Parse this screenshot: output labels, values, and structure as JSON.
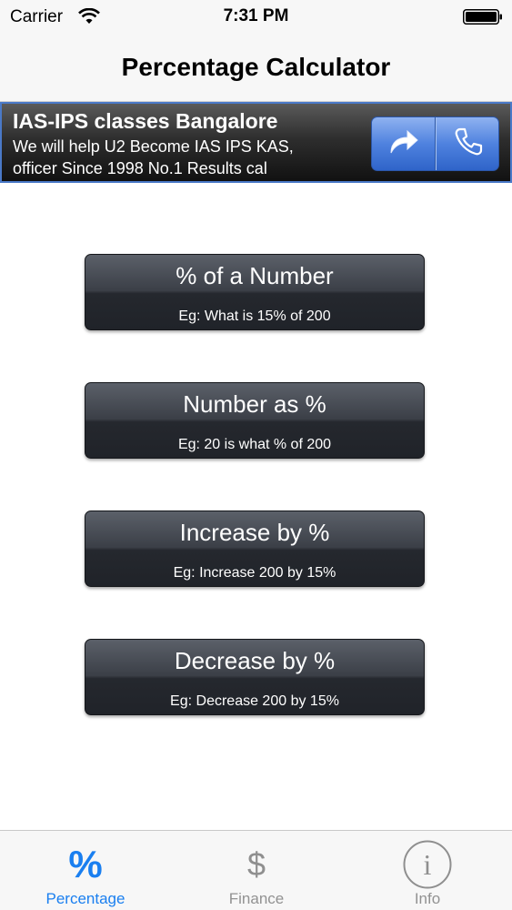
{
  "status_bar": {
    "carrier": "Carrier",
    "time": "7:31 PM"
  },
  "nav": {
    "title": "Percentage Calculator"
  },
  "ad": {
    "title": "IAS-IPS classes Bangalore",
    "line1": "We will help U2 Become IAS IPS KAS,",
    "line2": "officer Since 1998 No.1 Results cal",
    "buttons": [
      "share-arrow-icon",
      "phone-icon"
    ]
  },
  "calculators": [
    {
      "label": "% of a Number",
      "example": "Eg: What is 15% of 200"
    },
    {
      "label": "Number as %",
      "example": "Eg: 20 is what % of 200"
    },
    {
      "label": "Increase by %",
      "example": "Eg: Increase 200 by 15%"
    },
    {
      "label": "Decrease by %",
      "example": "Eg: Decrease 200 by 15%"
    }
  ],
  "tabs": [
    {
      "label": "Percentage",
      "icon": "%",
      "active": true
    },
    {
      "label": "Finance",
      "icon": "$",
      "active": false
    },
    {
      "label": "Info",
      "icon": "i",
      "active": false
    }
  ],
  "colors": {
    "accent": "#1a7ff0",
    "button_dark": "#2c2f36",
    "ad_blue": "#4f82df",
    "inactive": "#929292"
  }
}
